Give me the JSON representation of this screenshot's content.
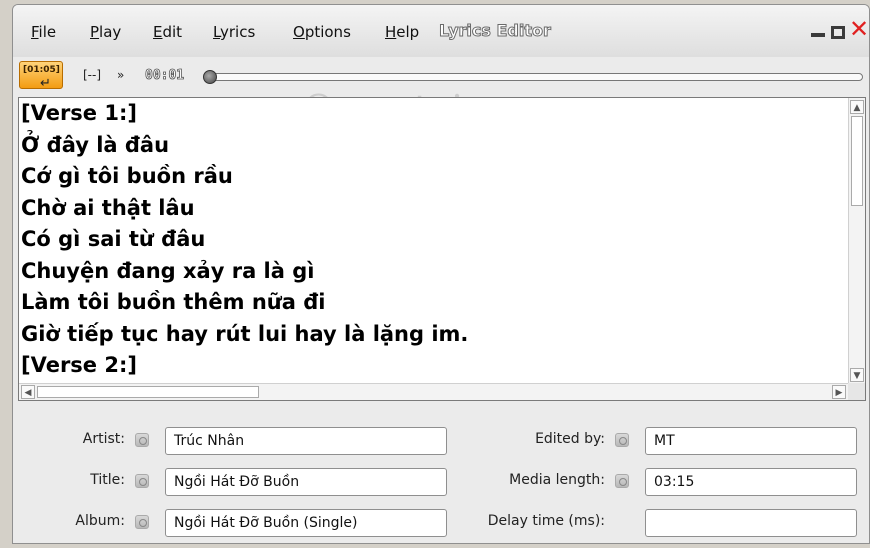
{
  "menu": {
    "file": {
      "u": "F",
      "rest": "ile"
    },
    "play": {
      "u": "P",
      "rest": "lay"
    },
    "edit": {
      "u": "E",
      "rest": "dit"
    },
    "lyrics": {
      "u": "L",
      "rest": "yrics"
    },
    "options": {
      "u": "O",
      "rest": "ptions"
    },
    "help": {
      "u": "H",
      "rest": "elp"
    }
  },
  "window": {
    "title": "Lyrics Editor"
  },
  "toolbar": {
    "time_tag": "[01:05]",
    "current_time": "00:01",
    "progress_fraction": 0.0
  },
  "watermark": "Quantrimang",
  "lyrics_text": "[Verse 1:]\nỞ đây là đâu\nCớ gì tôi buồn rầu\nChờ ai thật lâu\nCó gì sai từ đâu\nChuyện đang xảy ra là gì\nLàm tôi buồn thêm nữa đi\nGiờ tiếp tục hay rút lui hay là lặng im.\n[Verse 2:]",
  "form": {
    "artist_label": "Artist:",
    "artist_value": "Trúc Nhân",
    "title_label": "Title:",
    "title_value": "Ngồi Hát Đỡ Buồn",
    "album_label": "Album:",
    "album_value": "Ngồi Hát Đỡ Buồn (Single)",
    "edited_by_label": "Edited by:",
    "edited_by_value": "MT",
    "media_length_label": "Media length:",
    "media_length_value": "03:15",
    "delay_label": "Delay time (ms):",
    "delay_value": ""
  },
  "colors": {
    "close": "#e02020",
    "time_tag_bg": "#f39c12"
  }
}
